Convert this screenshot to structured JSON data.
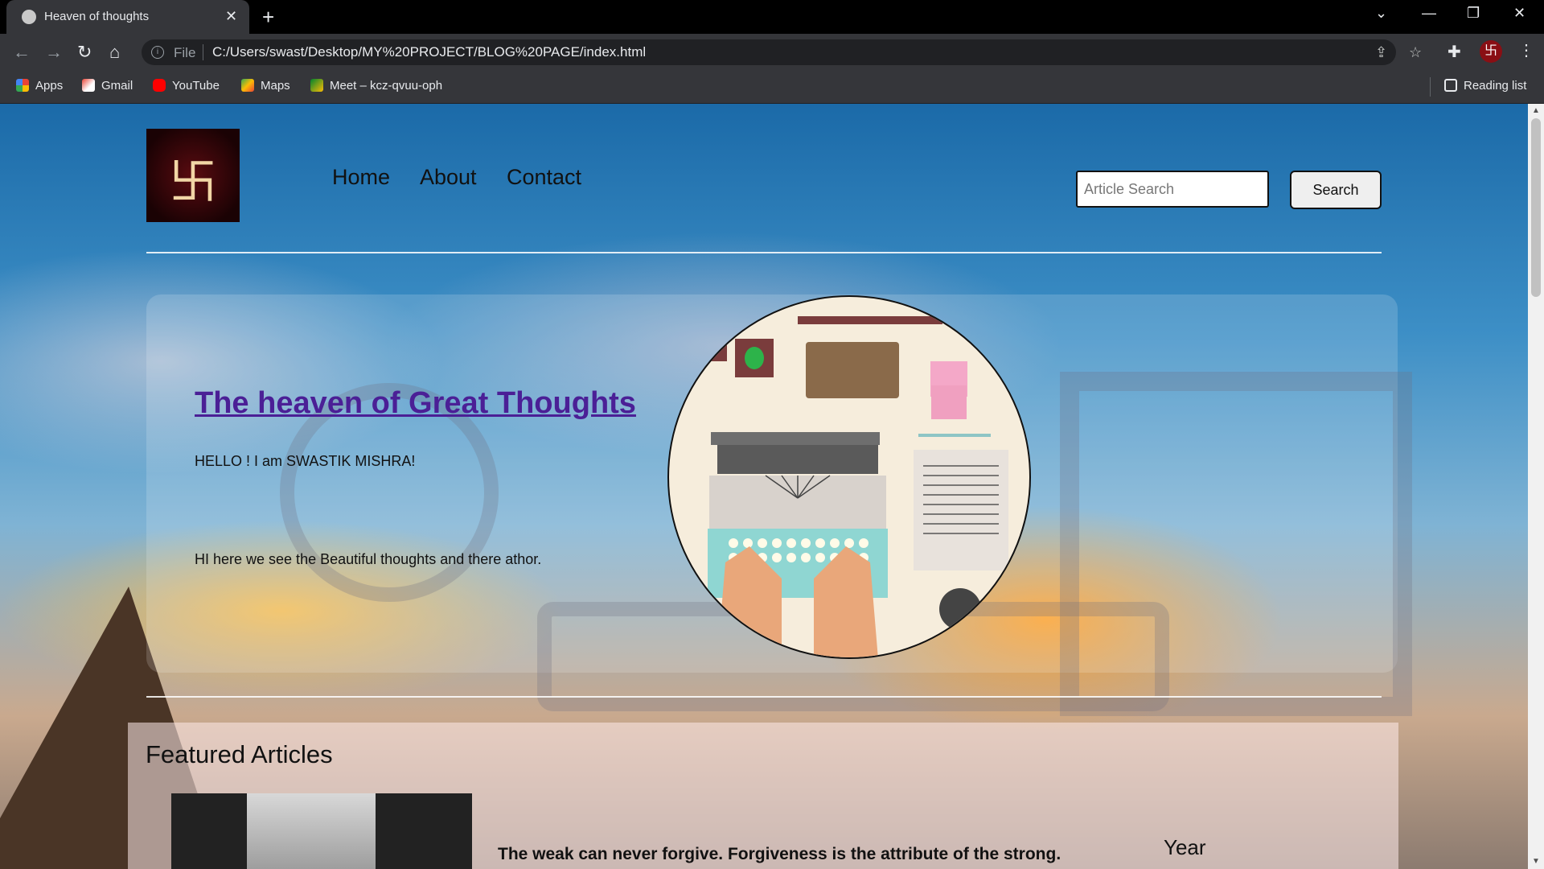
{
  "browser": {
    "tab_title": "Heaven of thoughts",
    "file_label": "File",
    "url": "C:/Users/swast/Desktop/MY%20PROJECT/BLOG%20PAGE/index.html",
    "reading_list": "Reading list",
    "bookmarks": [
      "Apps",
      "Gmail",
      "YouTube",
      "Maps",
      "Meet – kcz-qvuu-oph"
    ]
  },
  "nav": {
    "home": "Home",
    "about": "About",
    "contact": "Contact"
  },
  "search": {
    "placeholder": "Article Search",
    "button": "Search"
  },
  "hero": {
    "title": "The heaven of Great Thoughts",
    "line1": "HELLO ! I am SWASTIK MISHRA!",
    "line2": "HI here we see the Beautiful thoughts and there athor."
  },
  "featured": {
    "title": "Featured Articles",
    "quote": "The weak can never forgive. Forgiveness is the attribute of the strong.",
    "year_label": "Year"
  },
  "colors": {
    "title_purple": "#4b1f96",
    "logo_red": "#5a0b10",
    "chrome_dark": "#35363a"
  }
}
